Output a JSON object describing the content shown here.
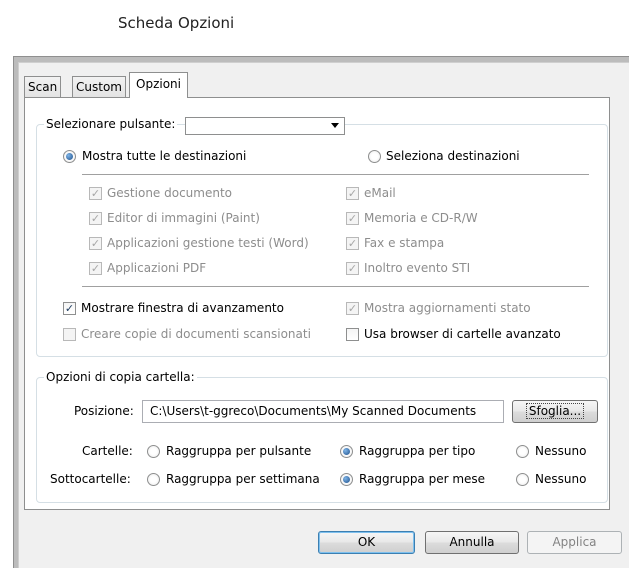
{
  "caption": "Scheda Opzioni",
  "tabs": [
    "Scan",
    "Custom",
    "Opzioni"
  ],
  "button_select": {
    "label": "Selezionare pulsante:",
    "value": ""
  },
  "destinations": {
    "show_all": "Mostra tutte le destinazioni",
    "select": "Seleziona destinazioni",
    "show_all_selected": true,
    "left": [
      "Gestione documento",
      "Editor di immagini (Paint)",
      "Applicazioni gestione testi (Word)",
      "Applicazioni  PDF"
    ],
    "right": [
      "eMail",
      "Memoria e CD-R/W",
      "Fax e stampa",
      "Inoltro evento STI"
    ]
  },
  "options": {
    "progress": "Mostrare finestra di avanzamento",
    "copies": "Creare copie di documenti scansionati",
    "status": "Mostra aggiornamenti stato",
    "browser": "Usa browser di cartelle avanzato"
  },
  "copy": {
    "legend": "Opzioni di copia cartella:",
    "position_label": "Posizione:",
    "path": "C:\\Users\\t-ggreco\\Documents\\My Scanned Documents",
    "browse": "Sfoglia...",
    "folders_label": "Cartelle:",
    "subfolders_label": "Sottocartelle:",
    "by_button": "Raggruppa per pulsante",
    "by_type": "Raggruppa per tipo",
    "by_week": "Raggruppa per settimana",
    "by_month": "Raggruppa per mese",
    "none": "Nessuno"
  },
  "footer": {
    "ok": "OK",
    "cancel": "Annulla",
    "apply": "Applica"
  }
}
